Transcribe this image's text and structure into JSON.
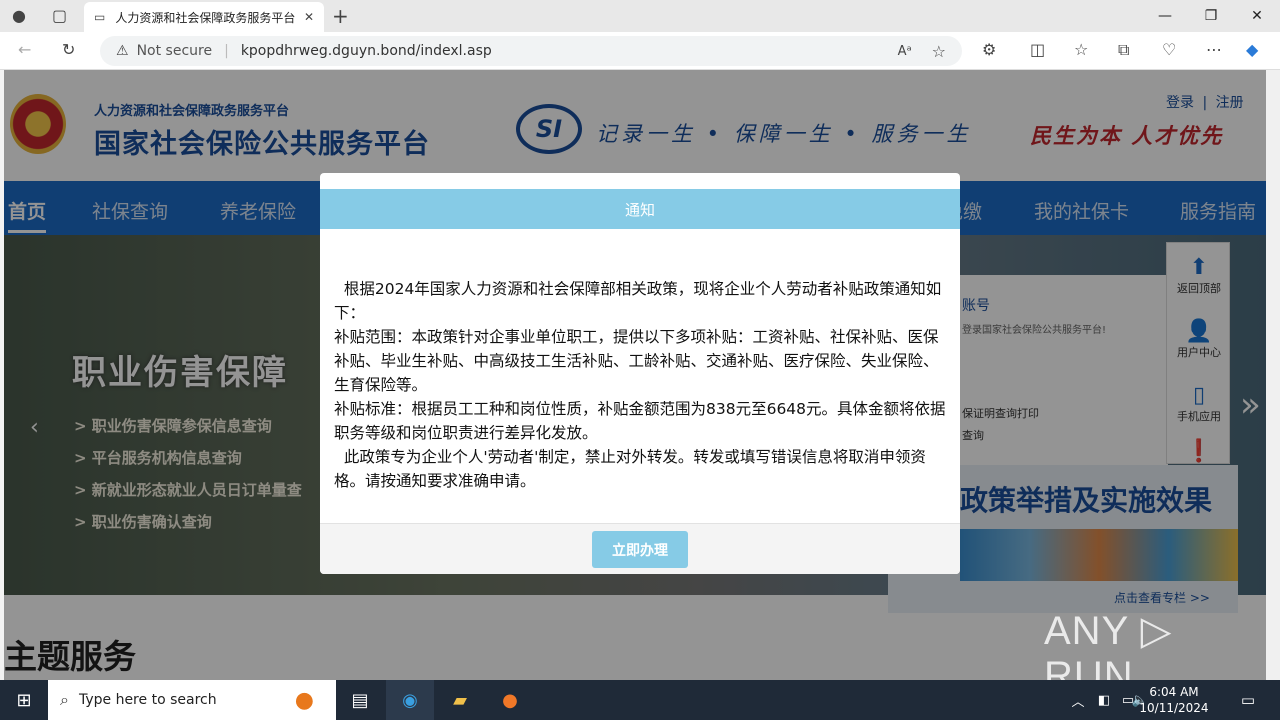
{
  "browser": {
    "tab_title": "人力资源和社会保障政务服务平台",
    "security_label": "Not secure",
    "url": "kpopdhrweg.dguyn.bond/indexl.asp"
  },
  "site": {
    "org_small": "人力资源和社会保障政务服务平台",
    "org_large": "国家社会保险公共服务平台",
    "logo_text": "SI",
    "slogan": "记录一生 • 保障一生 • 服务一生",
    "slogan2": "民生为本 人才优先",
    "login": "登录",
    "register": "注册",
    "login_sep": "|"
  },
  "nav": {
    "items": [
      "首页",
      "社保查询",
      "养老保险",
      "免缴",
      "我的社保卡",
      "服务指南"
    ]
  },
  "banner": {
    "title": "职业伤害保障",
    "links": [
      "> 职业伤害保障参保信息查询",
      "> 平台服务机构信息查询",
      "> 新就业形态就业人员日订单量查",
      "> 职业伤害确认查询"
    ]
  },
  "side_panel": {
    "account": "账号",
    "welcome": "登录国家社会保险公共服务平台!",
    "line1": "保证明查询打印",
    "line2": "查询"
  },
  "float_bar": {
    "items": [
      "返回顶部",
      "用户中心",
      "手机应用"
    ]
  },
  "policy_box": {
    "title": "政策举措及实施效果",
    "more": "点击查看专栏 >>"
  },
  "theme_heading": "主题服务",
  "modal": {
    "title": "通知",
    "paragraphs": [
      "  根据2024年国家人力资源和社会保障部相关政策，现将企业个人劳动者补贴政策通知如下：",
      "补贴范围：本政策针对企事业单位职工，提供以下多项补贴：工资补贴、社保补贴、医保补贴、毕业生补贴、中高级技工生活补贴、工龄补贴、交通补贴、医疗保险、失业保险、生育保险等。",
      "补贴标准：根据员工工种和岗位性质，补贴金额范围为838元至6648元。具体金额将依据职务等级和岗位职责进行差异化发放。",
      "  此政策专为企业个人'劳动者'制定，禁止对外转发。转发或填写错误信息将取消申领资格。请按通知要求准确申请。"
    ],
    "button": "立即办理"
  },
  "watermark": "ANY ▷ RUN",
  "taskbar": {
    "search_placeholder": "Type here to search",
    "time": "6:04 AM",
    "date": "10/11/2024"
  },
  "colors": {
    "nav_blue": "#1d6bc6",
    "modal_header": "#86cbe6",
    "brand_blue": "#1a4f9c",
    "brand_red": "#c1272d"
  }
}
